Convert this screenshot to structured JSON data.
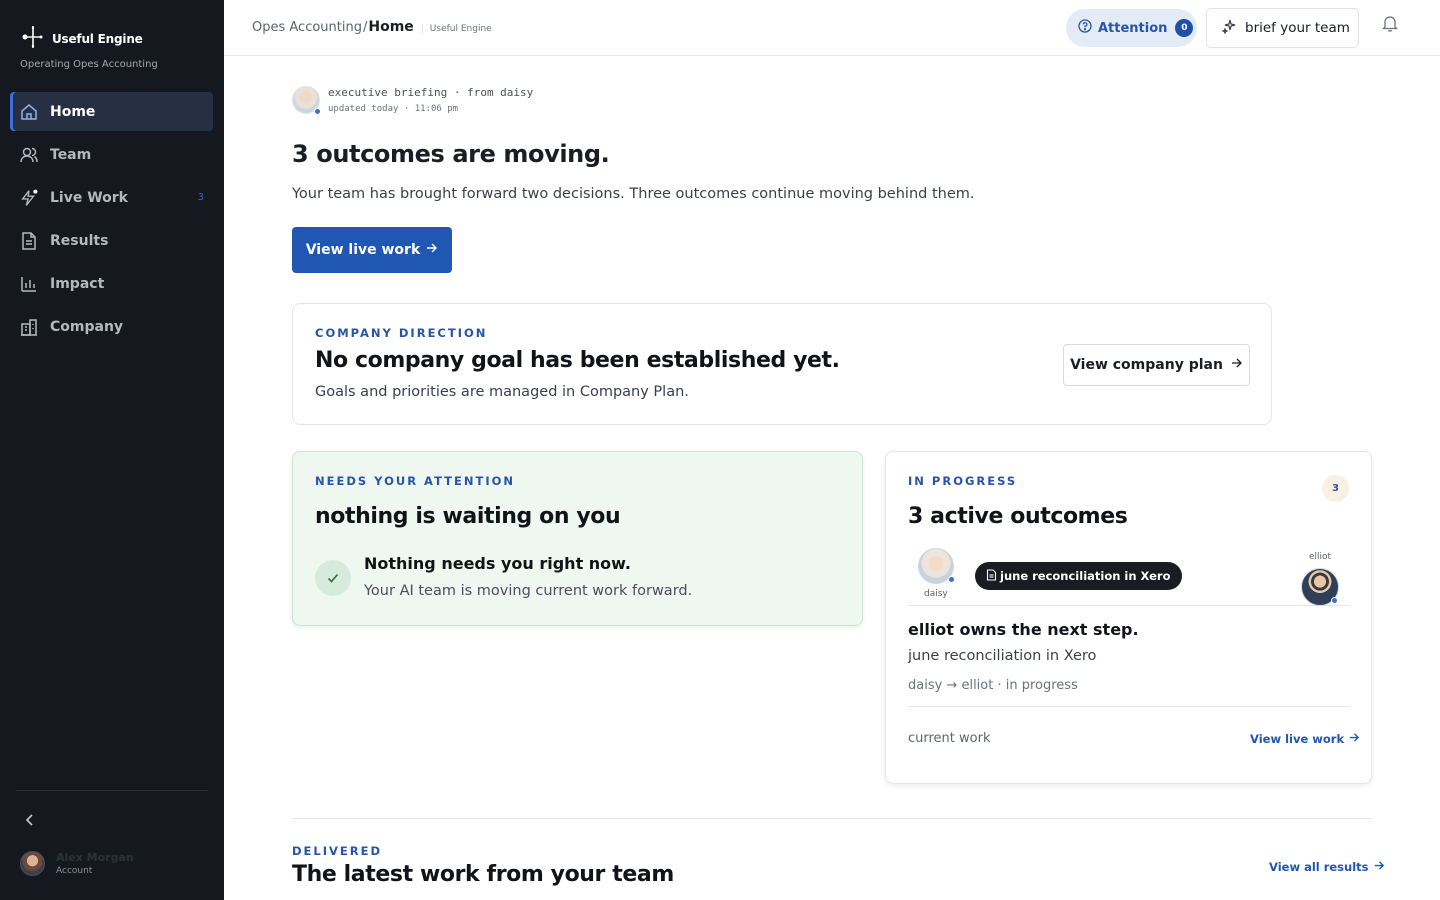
{
  "sidebar": {
    "brand": "Useful Engine",
    "subtitle": "Operating Opes Accounting",
    "items": [
      {
        "label": "Home",
        "icon": "home-icon",
        "active": true
      },
      {
        "label": "Team",
        "icon": "users-icon"
      },
      {
        "label": "Live Work",
        "icon": "bolt-icon",
        "count": "3"
      },
      {
        "label": "Results",
        "icon": "document-icon"
      },
      {
        "label": "Impact",
        "icon": "bar-chart-icon"
      },
      {
        "label": "Company",
        "icon": "building-icon"
      }
    ],
    "account": {
      "name": "Alex Morgan",
      "role": "Account"
    }
  },
  "topbar": {
    "org": "Opes Accounting",
    "separator": "/",
    "page": "Home",
    "workspace": "Useful Engine",
    "attention": {
      "label": "Attention",
      "count": "0"
    },
    "brief_button": "brief your team"
  },
  "briefing": {
    "line1": "executive briefing · from daisy",
    "line2": "updated today · 11:06 pm",
    "headline": "3 outcomes are moving.",
    "summary": "Your team has brought forward two decisions. Three outcomes continue moving behind them.",
    "cta": "View live work"
  },
  "direction": {
    "eyebrow": "COMPANY DIRECTION",
    "title": "No company goal has been established yet.",
    "subtitle": "Goals and priorities are managed in Company Plan.",
    "button": "View company plan"
  },
  "attention_card": {
    "eyebrow": "NEEDS YOUR ATTENTION",
    "title": "nothing is waiting on you",
    "line1": "Nothing needs you right now.",
    "line2": "Your AI team is moving current work forward."
  },
  "progress_card": {
    "eyebrow": "IN PROGRESS",
    "count": "3",
    "title": "3 active outcomes",
    "from_name": "daisy",
    "task_pill": "june reconciliation in Xero",
    "to_name": "elliot",
    "step_title": "elliot owns the next step.",
    "step_item": "june reconciliation in Xero",
    "step_meta": "daisy → elliot · in progress",
    "footer_label": "current work",
    "footer_link": "View live work"
  },
  "delivered": {
    "eyebrow": "DELIVERED",
    "title": "The latest work from your team",
    "link": "View all results"
  },
  "colors": {
    "sidebar_bg": "#15181f",
    "accent": "#1f57b3",
    "attention_bg": "#eef7f0"
  }
}
